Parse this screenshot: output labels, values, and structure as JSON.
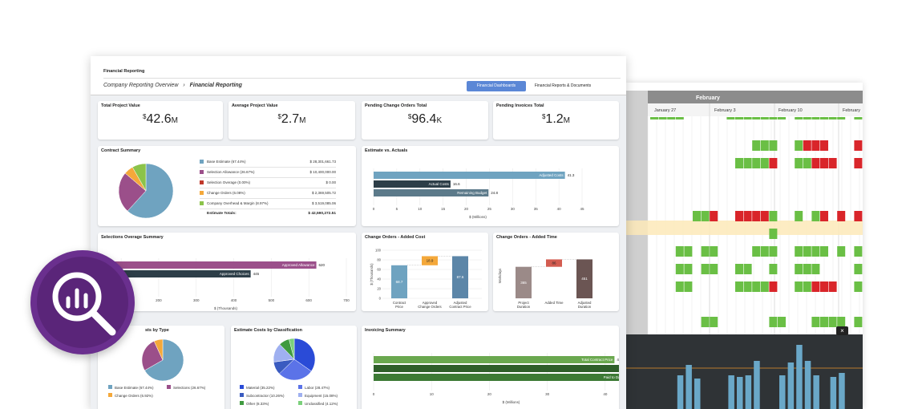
{
  "header": {
    "app_title": "Financial Reporting",
    "breadcrumb_parent": "Company Reporting Overview",
    "breadcrumb_sep": "›",
    "breadcrumb_current": "Financial Reporting",
    "tabs": [
      {
        "label": "Financial Dashboards",
        "active": true
      },
      {
        "label": "Financial Reports & Documents",
        "active": false
      }
    ]
  },
  "kpis": [
    {
      "title": "Total Project Value",
      "currency": "$",
      "value": "42.6",
      "suffix": "M"
    },
    {
      "title": "Average Project Value",
      "currency": "$",
      "value": "2.7",
      "suffix": "M"
    },
    {
      "title": "Pending Change Orders Total",
      "currency": "$",
      "value": "96.4",
      "suffix": "K"
    },
    {
      "title": "Pending Invoices Total",
      "currency": "$",
      "value": "1.2",
      "suffix": "M"
    }
  ],
  "contract_summary": {
    "title": "Contract Summary",
    "rows": [
      {
        "label": "Base Estimate (67.44%)",
        "value": "$ 28,301,661.73",
        "color": "#6fa3c0"
      },
      {
        "label": "Selection Allowance (26.67%)",
        "value": "$ 10,400,000.00",
        "color": "#9b4f8a"
      },
      {
        "label": "Selection Overage (0.00%)",
        "value": "$ 0.00",
        "color": "#c0392b"
      },
      {
        "label": "Change Orders (6.08%)",
        "value": "$ 2,369,505.72",
        "color": "#f4a83a"
      },
      {
        "label": "Company Overhead & Margin (8.97%)",
        "value": "$ 3,519,085.06",
        "color": "#8bc34a"
      }
    ],
    "total_label": "Estimate Totals:",
    "total_value": "$ 42,590,272.51"
  },
  "estimate_vs_actuals": {
    "title": "Estimate vs. Actuals",
    "bars": [
      {
        "label": "Adjusted Costs",
        "value": 41.3,
        "value_label": "41.3",
        "color": "#6fa3c0"
      },
      {
        "label": "Actual Costs",
        "value": 16.6,
        "value_label": "16.6",
        "color": "#2d3e48"
      },
      {
        "label": "Remaining Budget",
        "value": 24.8,
        "value_label": "24.8",
        "color": "#5c7a8a"
      }
    ],
    "ticks": [
      "0",
      "5",
      "10",
      "15",
      "20",
      "25",
      "30",
      "35",
      "40",
      "45"
    ],
    "xlabel": "$ (Millions)"
  },
  "selections_overage": {
    "title": "Selections Overage Summary",
    "bars": [
      {
        "label": "Approved Allowance",
        "value": 620,
        "value_label": "620",
        "color": "#9b4f8a"
      },
      {
        "label": "Approved Choices",
        "value": 445,
        "value_label": "445",
        "color": "#2d3e48"
      }
    ],
    "ticks": [
      "100",
      "200",
      "300",
      "400",
      "500",
      "600",
      "700"
    ],
    "xlabel": "$ (Thousands)"
  },
  "change_orders_cost": {
    "title": "Change Orders - Added Cost",
    "ylabel": "$ (Thousands)",
    "yticks": [
      "0",
      "20",
      "40",
      "60",
      "80",
      "100"
    ],
    "bars": [
      {
        "label": "Contract Price",
        "value": 68.7,
        "value_label": "68.7",
        "color": "#6fa3c0"
      },
      {
        "label": "Approved Change Orders",
        "value": 18.9,
        "value_label": "18.9",
        "color": "#f4a83a"
      },
      {
        "label": "Adjusted Contract Price",
        "value": 87.6,
        "value_label": "87.6",
        "color": "#5c86a8"
      }
    ]
  },
  "change_orders_time": {
    "title": "Change Orders - Added Time",
    "ylabel": "Workdays",
    "bars": [
      {
        "label": "Project Duration",
        "value": 365,
        "value_label": "365",
        "color": "#9b8a88"
      },
      {
        "label": "Added Time",
        "value": 86,
        "value_label": "86",
        "color": "#d35c50"
      },
      {
        "label": "Adjusted Duration",
        "value": 451,
        "value_label": "451",
        "color": "#6b5553"
      }
    ]
  },
  "costs_by_type": {
    "title": "sts by Type",
    "legend": [
      {
        "label": "Base Estimate (67.44%)",
        "color": "#6fa3c0"
      },
      {
        "label": "Selections (26.67%)",
        "color": "#9b4f8a"
      },
      {
        "label": "Change Orders (6.92%)",
        "color": "#f4a83a"
      }
    ]
  },
  "costs_by_classification": {
    "title": "Estimate Costs by Classification",
    "legend": [
      {
        "label": "Material (35.22%)",
        "color": "#2a4bd7"
      },
      {
        "label": "Labor (28.47%)",
        "color": "#5b73e8"
      },
      {
        "label": "Subcontractor (10.26%)",
        "color": "#3a5bc0"
      },
      {
        "label": "Equipment (15.08%)",
        "color": "#9fb0f0"
      },
      {
        "label": "Other (8.33%)",
        "color": "#3f9a3f"
      },
      {
        "label": "Unclassified (4.12%)",
        "color": "#7bd07b"
      }
    ]
  },
  "invoicing": {
    "title": "Invoicing Summary",
    "bars": [
      {
        "label": "Total Contract Price",
        "value": 41.6,
        "value_label": "41.6",
        "color": "#6aa84f"
      },
      {
        "label": "Invoiced to Date",
        "value": 58.1,
        "value_label": "58.1",
        "color": "#2f5f2a"
      },
      {
        "label": "Paid to Date",
        "value": 43.4,
        "value_label": "43.4",
        "color": "#3d7a35"
      }
    ],
    "ticks": [
      "0",
      "10",
      "20",
      "30",
      "40"
    ],
    "xlabel": "$ (Millions)"
  },
  "gantt": {
    "month": "February",
    "weeks": [
      "January 27",
      "February 3",
      "February 10",
      "February"
    ]
  },
  "overlay": {
    "close_label": "×",
    "badge_icon": "analytics-search-icon"
  }
}
